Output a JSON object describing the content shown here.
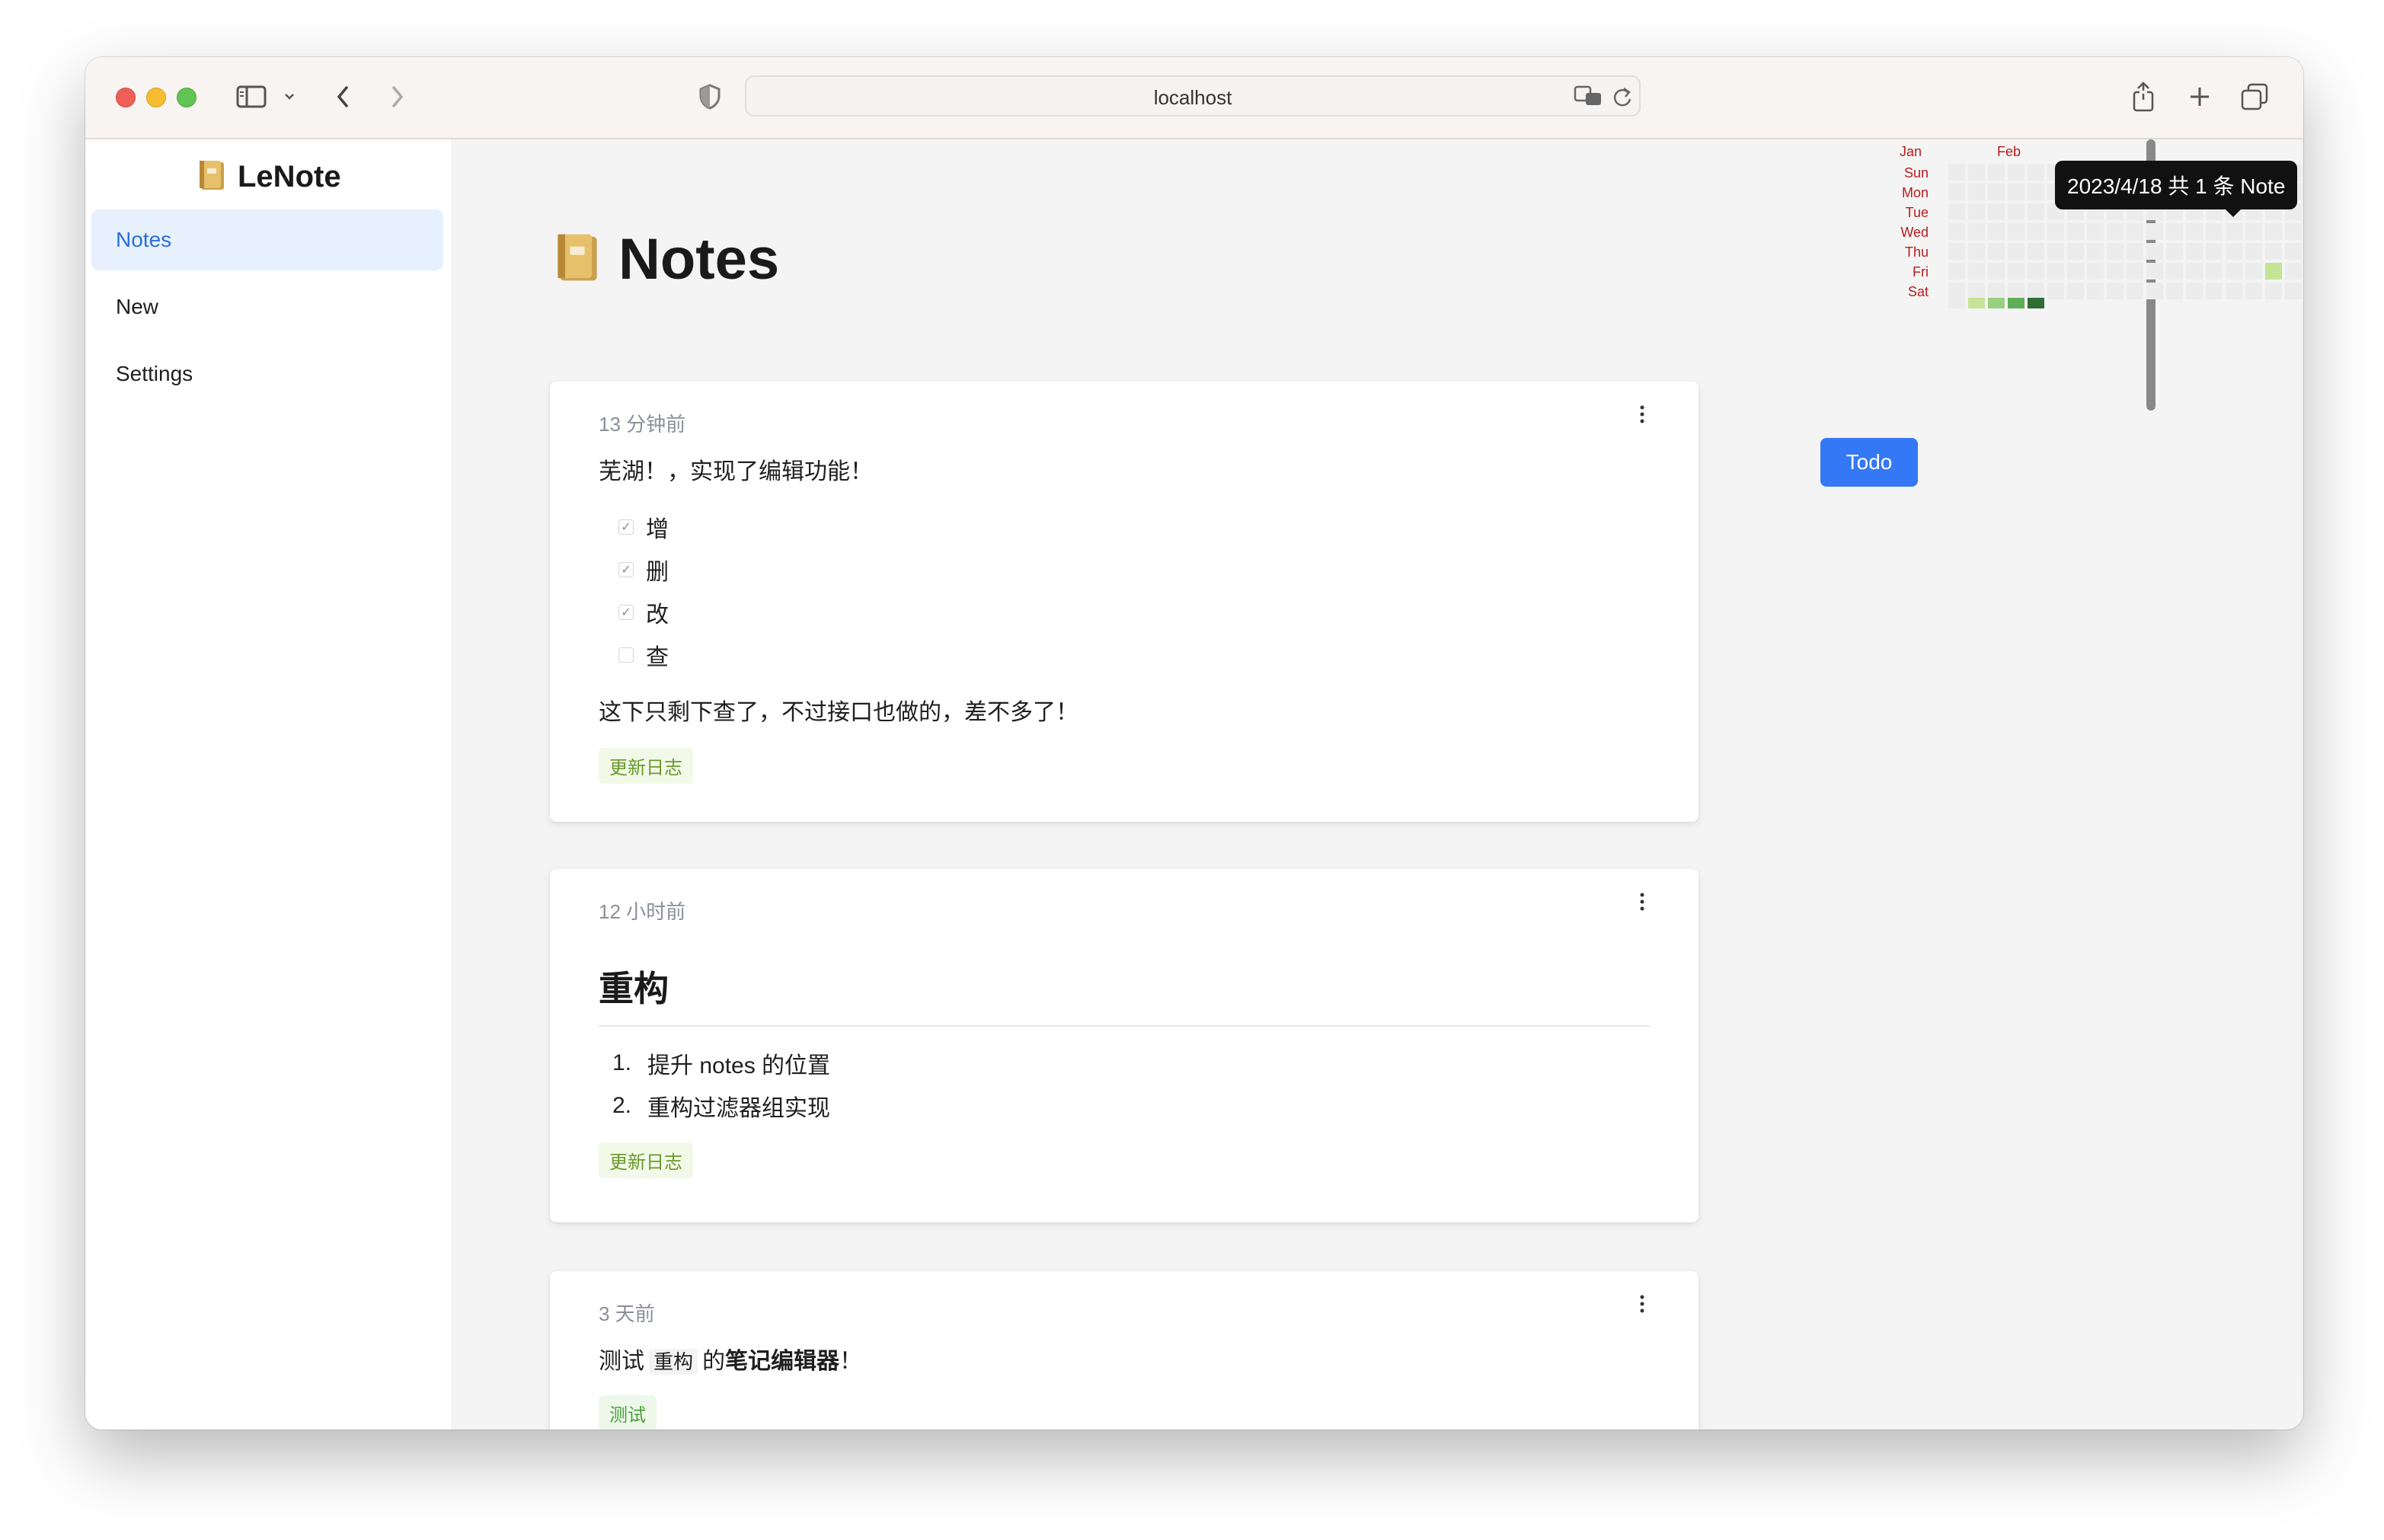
{
  "browser": {
    "url": "localhost"
  },
  "sidebar": {
    "brand": "LeNote",
    "items": [
      {
        "label": "Notes",
        "active": true
      },
      {
        "label": "New",
        "active": false
      },
      {
        "label": "Settings",
        "active": false
      }
    ]
  },
  "main": {
    "title": "Notes"
  },
  "notes": [
    {
      "time": "13 分钟前",
      "text": "芜湖！，实现了编辑功能！",
      "checklist": [
        {
          "label": "增",
          "checked": true
        },
        {
          "label": "删",
          "checked": true
        },
        {
          "label": "改",
          "checked": true
        },
        {
          "label": "查",
          "checked": false
        }
      ],
      "text2": "这下只剩下查了，不过接口也做的，差不多了！",
      "tag": "更新日志"
    },
    {
      "time": "12 小时前",
      "heading": "重构",
      "list": [
        "提升 notes 的位置",
        "重构过滤器组实现"
      ],
      "tag": "更新日志"
    },
    {
      "time": "3 天前",
      "text_pre": "测试",
      "code": "重构",
      "text_mid": "的",
      "text_bold": "笔记编辑器",
      "text_post": "！",
      "tag": "测试"
    }
  ],
  "heatmap": {
    "months": [
      "Jan",
      "Feb"
    ],
    "days": [
      "Sun",
      "Mon",
      "Tue",
      "Wed",
      "Thu",
      "Fri",
      "Sat"
    ],
    "tooltip": "2023/4/18 共 1 条 Note",
    "colors": {
      "empty": "#ececec",
      "l1": "#c5e496",
      "l2": "#99d080",
      "l3": "#5fae57",
      "l4": "#2f6d34",
      "month_label": "#b71c1c"
    }
  },
  "todo_button": "Todo"
}
